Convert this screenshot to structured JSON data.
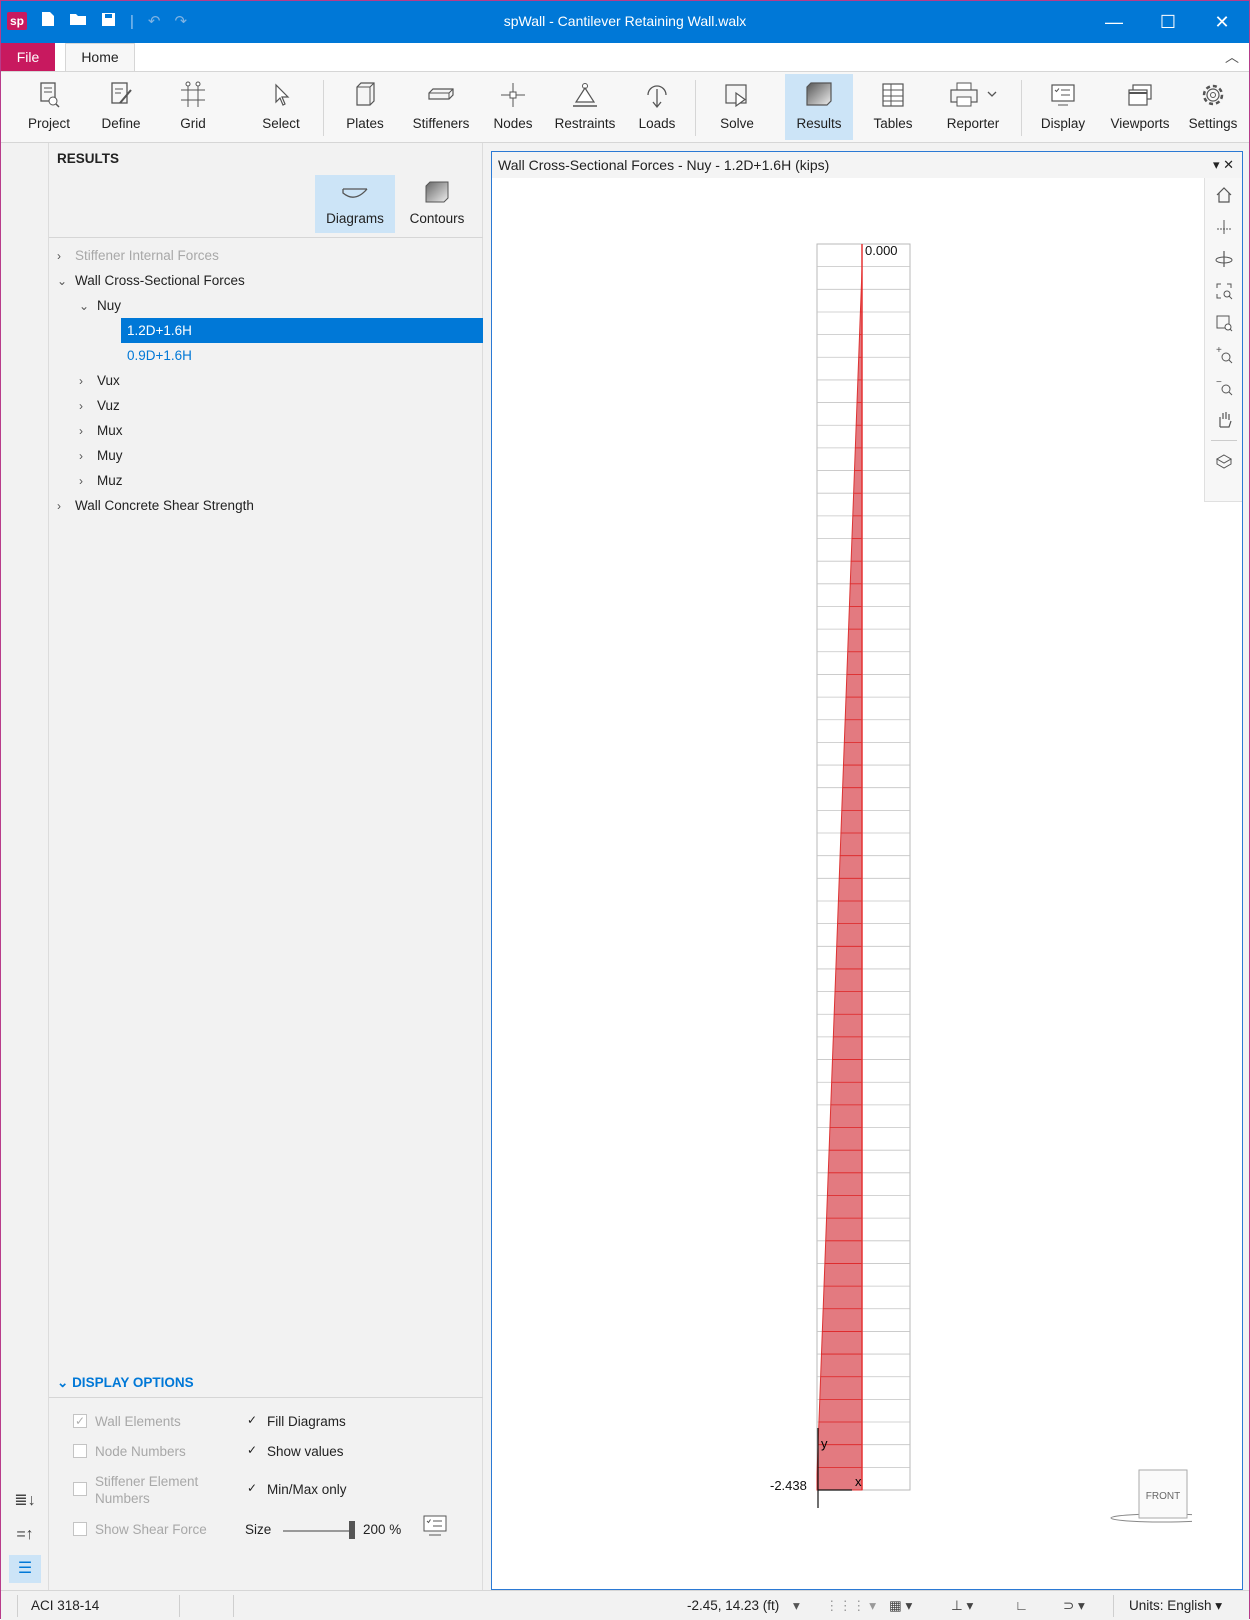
{
  "window": {
    "title": "spWall - Cantilever Retaining Wall.walx",
    "logo": "sp",
    "minimize": "—",
    "maximize": "☐",
    "close": "✕"
  },
  "tabs": {
    "file": "File",
    "home": "Home"
  },
  "ribbon": [
    {
      "label": "Project",
      "icon": "project-icon"
    },
    {
      "label": "Define",
      "icon": "define-icon"
    },
    {
      "label": "Grid",
      "icon": "grid-icon"
    },
    {
      "label": "Select",
      "icon": "select-icon"
    },
    {
      "label": "Plates",
      "icon": "plates-icon"
    },
    {
      "label": "Stiffeners",
      "icon": "stiffeners-icon"
    },
    {
      "label": "Nodes",
      "icon": "nodes-icon"
    },
    {
      "label": "Restraints",
      "icon": "restraints-icon"
    },
    {
      "label": "Loads",
      "icon": "loads-icon"
    },
    {
      "label": "Solve",
      "icon": "solve-icon"
    },
    {
      "label": "Results",
      "icon": "results-icon",
      "active": true
    },
    {
      "label": "Tables",
      "icon": "tables-icon"
    },
    {
      "label": "Reporter",
      "icon": "reporter-icon"
    },
    {
      "label": "Display",
      "icon": "display-icon"
    },
    {
      "label": "Viewports",
      "icon": "viewports-icon"
    },
    {
      "label": "Settings",
      "icon": "settings-icon"
    }
  ],
  "panel": {
    "header": "RESULTS",
    "mode_buttons": {
      "diagrams": "Diagrams",
      "contours": "Contours"
    },
    "tree": {
      "stiffener_forces": "Stiffener Internal Forces",
      "wall_forces": "Wall Cross-Sectional Forces",
      "nuy": "Nuy",
      "combo_1": "1.2D+1.6H",
      "combo_2": "0.9D+1.6H",
      "vux": "Vux",
      "vuz": "Vuz",
      "mux": "Mux",
      "muy": "Muy",
      "muz": "Muz",
      "shear_strength": "Wall Concrete Shear Strength"
    },
    "display_options": {
      "header": "DISPLAY OPTIONS",
      "wall_elements": "Wall Elements",
      "node_numbers": "Node Numbers",
      "stiffener_numbers": "Stiffener Element Numbers",
      "show_shear": "Show Shear Force",
      "fill_diagrams": "Fill Diagrams",
      "show_values": "Show values",
      "minmax_only": "Min/Max only",
      "size_label": "Size",
      "size_value": "200 %"
    }
  },
  "viewport": {
    "title": "Wall Cross-Sectional Forces - Nuy - 1.2D+1.6H (kips)",
    "top_value": "0.000",
    "bottom_value": "-2.438",
    "axis_x": "x",
    "axis_y": "y",
    "view_cube": "FRONT",
    "controls": "▾ ✕"
  },
  "status": {
    "code": "ACI 318-14",
    "coords": "-2.45, 14.23 (ft)",
    "units": "Units:  English"
  }
}
